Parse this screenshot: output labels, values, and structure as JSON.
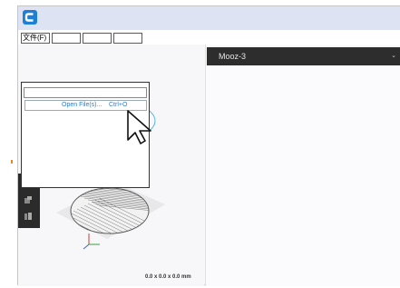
{
  "app": {
    "logo_icon": "app-logo-icon",
    "accent": "#1e7fd6"
  },
  "menu": {
    "file_label": "文件(F)",
    "empty_items": [
      "",
      "",
      ""
    ]
  },
  "dropdown": {
    "item_label": "Open File(s)...",
    "item_shortcut": "Ctrl+O"
  },
  "panel": {
    "machine": "Mooz-3",
    "chevron_icon": "chevron-down-icon"
  },
  "viewport": {
    "dimensions": "0.0 x 0.0 x 0.0 mm"
  }
}
